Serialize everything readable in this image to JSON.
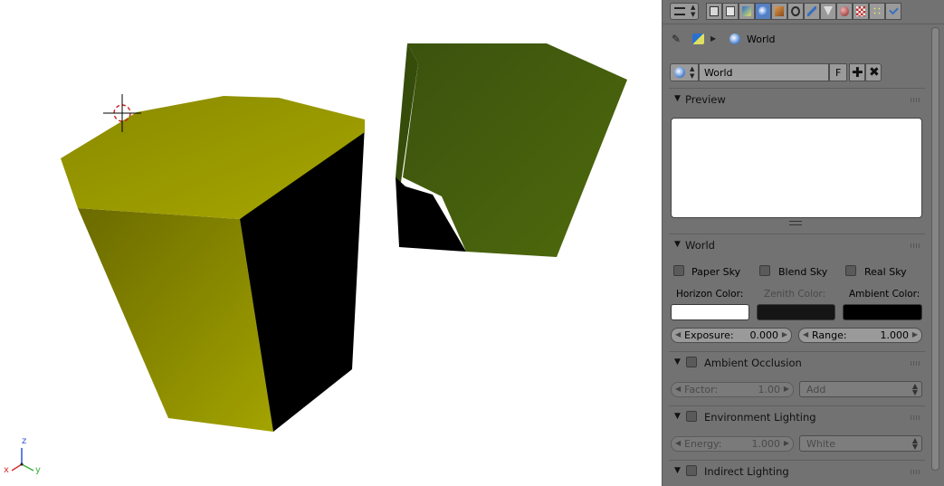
{
  "properties": {
    "breadcrumb": {
      "world_label": "World"
    },
    "datablock": {
      "name": "World",
      "fake_user_label": "F"
    },
    "preview": {
      "header": "Preview"
    },
    "world": {
      "header": "World",
      "paper_sky": "Paper Sky",
      "blend_sky": "Blend Sky",
      "real_sky": "Real Sky",
      "horizon_label": "Horizon Color:",
      "zenith_label": "Zenith Color:",
      "ambient_label": "Ambient Color:",
      "horizon_color": "#ffffff",
      "zenith_color": "#151515",
      "ambient_color": "#000000",
      "exposure_label": "Exposure:",
      "exposure_value": "0.000",
      "range_label": "Range:",
      "range_value": "1.000"
    },
    "ambient_occlusion": {
      "header": "Ambient Occlusion",
      "factor_label": "Factor:",
      "factor_value": "1.00",
      "blend_mode": "Add"
    },
    "environment_lighting": {
      "header": "Environment Lighting",
      "energy_label": "Energy:",
      "energy_value": "1.000",
      "color_mode": "White"
    },
    "indirect_lighting": {
      "header": "Indirect Lighting"
    }
  },
  "viewport": {
    "axis_x": "x",
    "axis_y": "y",
    "axis_z": "z",
    "colors": {
      "prism_top": "#969600",
      "prism_front": "#787800",
      "cube_front": "#465f0c",
      "shadow": "#000000"
    }
  },
  "icons": {
    "editor_type": "properties-editor-icon",
    "tabs": [
      "render-icon",
      "render-layers-icon",
      "scene-icon",
      "world-icon",
      "object-icon",
      "constraints-icon",
      "modifiers-icon",
      "data-icon",
      "material-icon",
      "texture-icon",
      "particles-icon",
      "physics-icon"
    ]
  }
}
